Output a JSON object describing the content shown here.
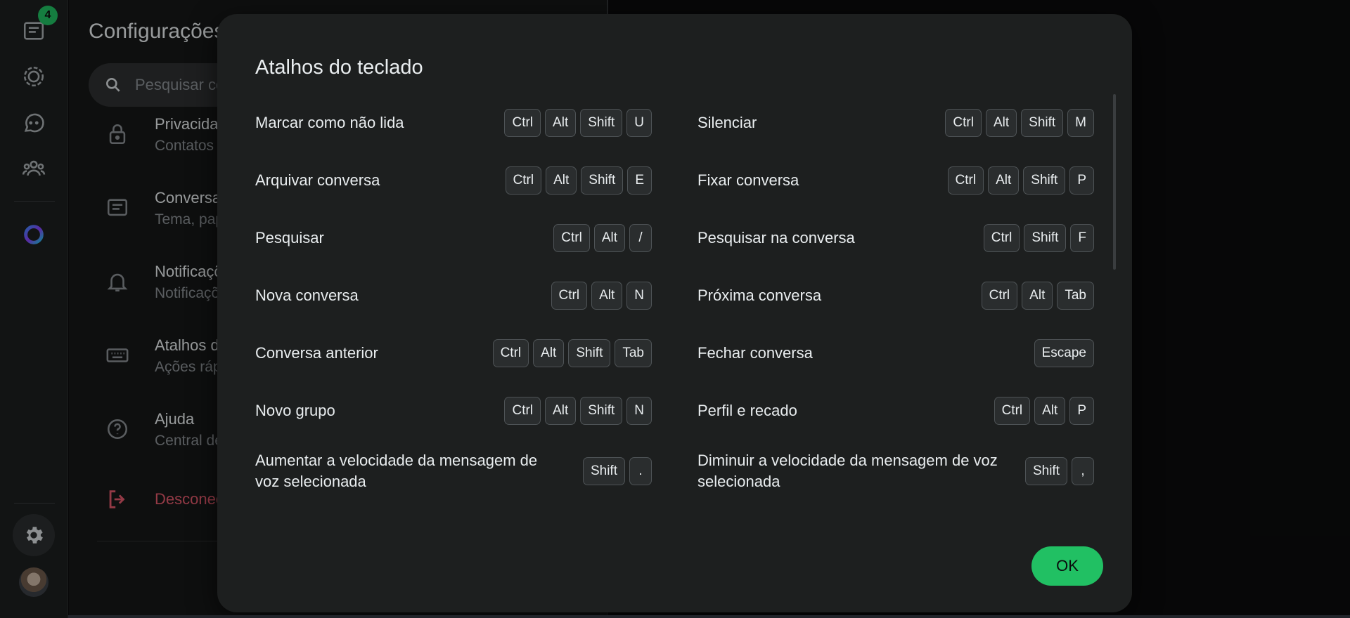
{
  "rail": {
    "chats_badge": "4",
    "icons": [
      "chats-icon",
      "status-icon",
      "channels-icon",
      "communities-icon",
      "meta-ai-icon",
      "settings-icon",
      "profile-avatar"
    ]
  },
  "settings": {
    "title": "Configurações",
    "search_placeholder": "Pesquisar configurações",
    "items": [
      {
        "title": "Privacidade",
        "subtitle": "Contatos bloqueados, mensagens temporárias",
        "icon": "lock-icon"
      },
      {
        "title": "Conversas",
        "subtitle": "Tema, papel de parede, configurações de conversas",
        "icon": "chat-icon"
      },
      {
        "title": "Notificações",
        "subtitle": "Notificações de mensagens",
        "icon": "bell-icon"
      },
      {
        "title": "Atalhos do teclado",
        "subtitle": "Ações rápidas",
        "icon": "keyboard-icon"
      },
      {
        "title": "Ajuda",
        "subtitle": "Central de ajuda, fale conosco, política de privacidade",
        "icon": "help-icon"
      },
      {
        "title": "Desconectar",
        "subtitle": "",
        "icon": "logout-icon"
      }
    ]
  },
  "modal": {
    "title": "Atalhos do teclado",
    "ok_label": "OK",
    "shortcuts_left": [
      {
        "label": "Marcar como não lida",
        "keys": [
          "Ctrl",
          "Alt",
          "Shift",
          "U"
        ]
      },
      {
        "label": "Arquivar conversa",
        "keys": [
          "Ctrl",
          "Alt",
          "Shift",
          "E"
        ]
      },
      {
        "label": "Pesquisar",
        "keys": [
          "Ctrl",
          "Alt",
          "/"
        ]
      },
      {
        "label": "Nova conversa",
        "keys": [
          "Ctrl",
          "Alt",
          "N"
        ]
      },
      {
        "label": "Conversa anterior",
        "keys": [
          "Ctrl",
          "Alt",
          "Shift",
          "Tab"
        ]
      },
      {
        "label": "Novo grupo",
        "keys": [
          "Ctrl",
          "Alt",
          "Shift",
          "N"
        ]
      },
      {
        "label": "Aumentar a velocidade da mensagem de voz selecionada",
        "keys": [
          "Shift",
          "."
        ]
      }
    ],
    "shortcuts_right": [
      {
        "label": "Silenciar",
        "keys": [
          "Ctrl",
          "Alt",
          "Shift",
          "M"
        ]
      },
      {
        "label": "Fixar conversa",
        "keys": [
          "Ctrl",
          "Alt",
          "Shift",
          "P"
        ]
      },
      {
        "label": "Pesquisar na conversa",
        "keys": [
          "Ctrl",
          "Shift",
          "F"
        ]
      },
      {
        "label": "Próxima conversa",
        "keys": [
          "Ctrl",
          "Alt",
          "Tab"
        ]
      },
      {
        "label": "Fechar conversa",
        "keys": [
          "Escape"
        ]
      },
      {
        "label": "Perfil e recado",
        "keys": [
          "Ctrl",
          "Alt",
          "P"
        ]
      },
      {
        "label": "Diminuir a velocidade da mensagem de voz selecionada",
        "keys": [
          "Shift",
          ","
        ]
      }
    ]
  },
  "colors": {
    "accent": "#21c063",
    "danger": "#e35a6c",
    "modal_bg": "#1d1f1f",
    "key_bg": "#2a2d2e"
  }
}
